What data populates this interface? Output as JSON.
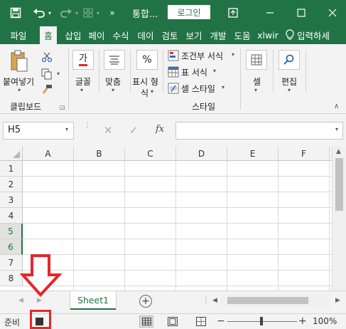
{
  "titlebar": {
    "doc_title": "통합...",
    "login_label": "로그인",
    "icons": [
      "save-icon",
      "undo-icon",
      "redo-icon",
      "customize-icon",
      "restore-window-icon",
      "minimize-icon",
      "maximize-icon"
    ]
  },
  "tabs": [
    {
      "label": "파일"
    },
    {
      "label": "홈"
    },
    {
      "label": "삽입"
    },
    {
      "label": "페이"
    },
    {
      "label": "수식"
    },
    {
      "label": "데이"
    },
    {
      "label": "검토"
    },
    {
      "label": "보기"
    },
    {
      "label": "개발"
    },
    {
      "label": "도움"
    },
    {
      "label": "xlwir"
    },
    {
      "label": "입력하세"
    }
  ],
  "ribbon": {
    "paste_label": "붙여넣기",
    "clipboard_group": "클립보드",
    "font_label": "글꼴",
    "font_icon_text": "가",
    "align_label": "맞춤",
    "number_label": "표시 형",
    "number_label2": "식",
    "number_icon_text": "%",
    "cond_format": "조건부 서식",
    "table_format": "표 서식",
    "cell_style": "셀 스타일",
    "style_group": "스타일",
    "cells_label": "셀",
    "edit_label": "편집"
  },
  "formula_bar": {
    "name_box": "H5",
    "fx": "fx",
    "formula_value": ""
  },
  "grid": {
    "columns": [
      "A",
      "B",
      "C",
      "D",
      "E",
      "F"
    ],
    "rows": [
      "1",
      "2",
      "3",
      "4",
      "5",
      "6",
      "7",
      "8"
    ],
    "selected_rows": [
      "5",
      "6"
    ]
  },
  "sheets": {
    "tabs": [
      "Sheet1"
    ],
    "active": "Sheet1"
  },
  "status": {
    "ready": "준비",
    "zoom": "100%"
  },
  "colors": {
    "accent": "#217346",
    "annotation": "#e5262b"
  }
}
